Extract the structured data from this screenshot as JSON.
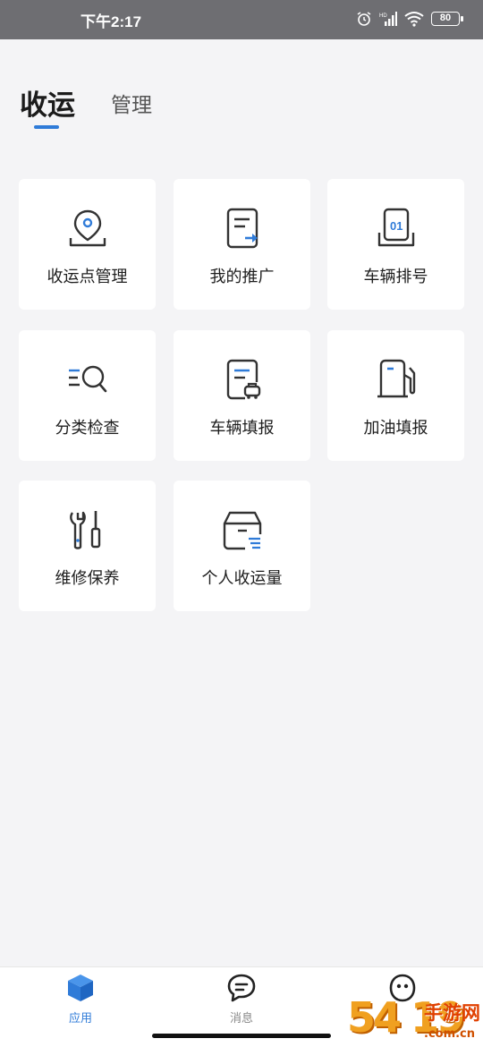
{
  "status_bar": {
    "time": "下午2:17",
    "battery": "80"
  },
  "tabs": [
    {
      "label": "收运",
      "active": true
    },
    {
      "label": "管理",
      "active": false
    }
  ],
  "grid": [
    {
      "label": "收运点管理",
      "icon": "location-pin-icon"
    },
    {
      "label": "我的推广",
      "icon": "document-share-icon"
    },
    {
      "label": "车辆排号",
      "icon": "vehicle-queue-icon"
    },
    {
      "label": "分类检查",
      "icon": "list-search-icon"
    },
    {
      "label": "车辆填报",
      "icon": "vehicle-report-icon"
    },
    {
      "label": "加油填报",
      "icon": "fuel-pump-icon"
    },
    {
      "label": "维修保养",
      "icon": "wrench-screwdriver-icon"
    },
    {
      "label": "个人收运量",
      "icon": "box-list-icon"
    }
  ],
  "bottom_nav": [
    {
      "label": "应用",
      "icon": "cube-icon",
      "active": true
    },
    {
      "label": "消息",
      "icon": "chat-bubble-icon",
      "active": false
    },
    {
      "label": "",
      "icon": "face-icon",
      "active": false
    }
  ],
  "watermark": {
    "big": "54 19",
    "site": "手游网",
    "domain": ".com.cn"
  },
  "colors": {
    "accent": "#2f7bd8",
    "background": "#f4f4f6",
    "icon_stroke": "#333333"
  }
}
